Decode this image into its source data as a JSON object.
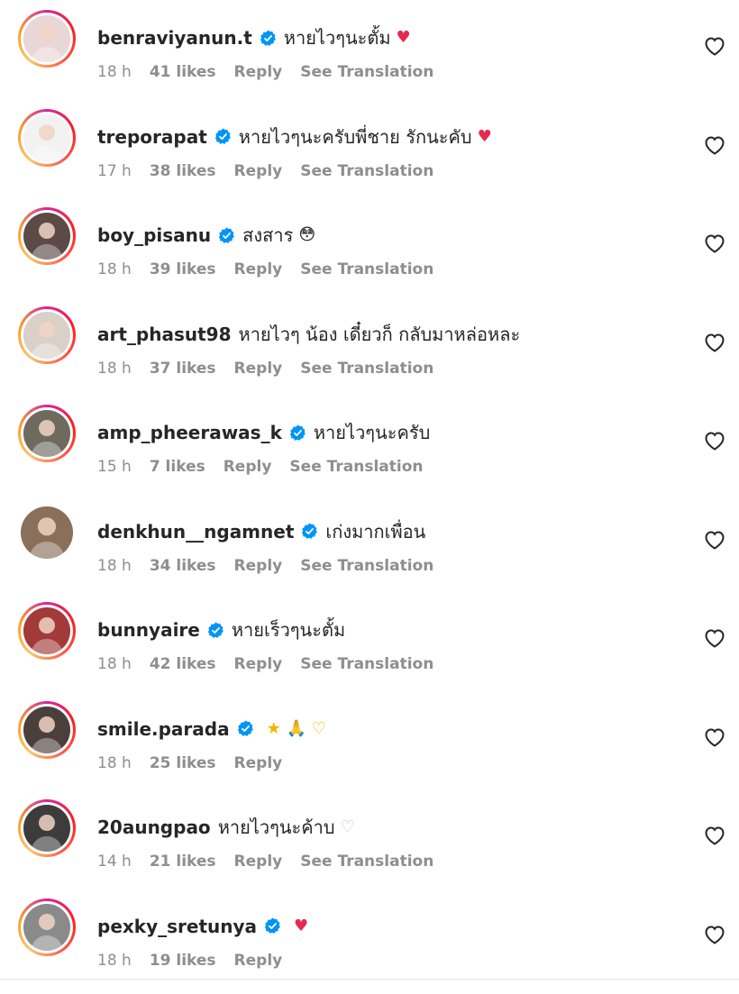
{
  "colors": {
    "text": "#262626",
    "meta": "#8e8e8e",
    "verified": "#0095f6",
    "heart": "#e8294f"
  },
  "comments": [
    {
      "username": "benraviyanun.t",
      "verified": true,
      "text": "หายไวๆนะตั้ม",
      "emoji": "♥",
      "time": "18 h",
      "likes": "41 likes",
      "reply": "Reply",
      "translate": "See Translation",
      "avatar_bg": "#e9d6d6",
      "ring": true
    },
    {
      "username": "treporapat",
      "verified": true,
      "text": "หายไวๆนะครับพี่ชาย รักนะคับ",
      "emoji": "♥",
      "time": "17 h",
      "likes": "38 likes",
      "reply": "Reply",
      "translate": "See Translation",
      "avatar_bg": "#f2f2f2",
      "ring": true
    },
    {
      "username": "boy_pisanu",
      "verified": true,
      "text": "สงสาร",
      "emoji": "😳",
      "time": "18 h",
      "likes": "39 likes",
      "reply": "Reply",
      "translate": "See Translation",
      "avatar_bg": "#5b4a45",
      "ring": true
    },
    {
      "username": "art_phasut98",
      "verified": false,
      "text": "หายไวๆ น้อง เดี๋ยวก็ กลับมาหล่อหละ",
      "emoji": "",
      "time": "18 h",
      "likes": "37 likes",
      "reply": "Reply",
      "translate": "See Translation",
      "avatar_bg": "#d9d0c8",
      "ring": true
    },
    {
      "username": "amp_pheerawas_k",
      "verified": true,
      "text": "หายไวๆนะครับ",
      "emoji": "",
      "time": "15 h",
      "likes": "7 likes",
      "reply": "Reply",
      "translate": "See Translation",
      "avatar_bg": "#6e6a5e",
      "ring": true
    },
    {
      "username": "denkhun__ngamnet",
      "verified": true,
      "text": "เก่งมากเพื่อน",
      "emoji": "",
      "time": "18 h",
      "likes": "34 likes",
      "reply": "Reply",
      "translate": "See Translation",
      "avatar_bg": "#8a6f5a",
      "ring": false
    },
    {
      "username": "bunnyaire",
      "verified": true,
      "text": "หายเร็วๆนะตั้ม",
      "emoji": "",
      "time": "18 h",
      "likes": "42 likes",
      "reply": "Reply",
      "translate": "See Translation",
      "avatar_bg": "#a33a3a",
      "ring": true
    },
    {
      "username": "smile.parada",
      "verified": true,
      "text": "",
      "emoji": "★ 🙏 ♡",
      "time": "18 h",
      "likes": "25 likes",
      "reply": "Reply",
      "translate": "",
      "avatar_bg": "#4a3f3a",
      "ring": true
    },
    {
      "username": "20aungpao",
      "verified": false,
      "text": "หายไวๆนะค้าบ",
      "emoji": "♡",
      "time": "14 h",
      "likes": "21 likes",
      "reply": "Reply",
      "translate": "See Translation",
      "avatar_bg": "#3c3c3c",
      "ring": true
    },
    {
      "username": "pexky_sretunya",
      "verified": true,
      "text": "",
      "emoji": "♥",
      "time": "18 h",
      "likes": "19 likes",
      "reply": "Reply",
      "translate": "",
      "avatar_bg": "#8a8a8a",
      "ring": true
    }
  ]
}
